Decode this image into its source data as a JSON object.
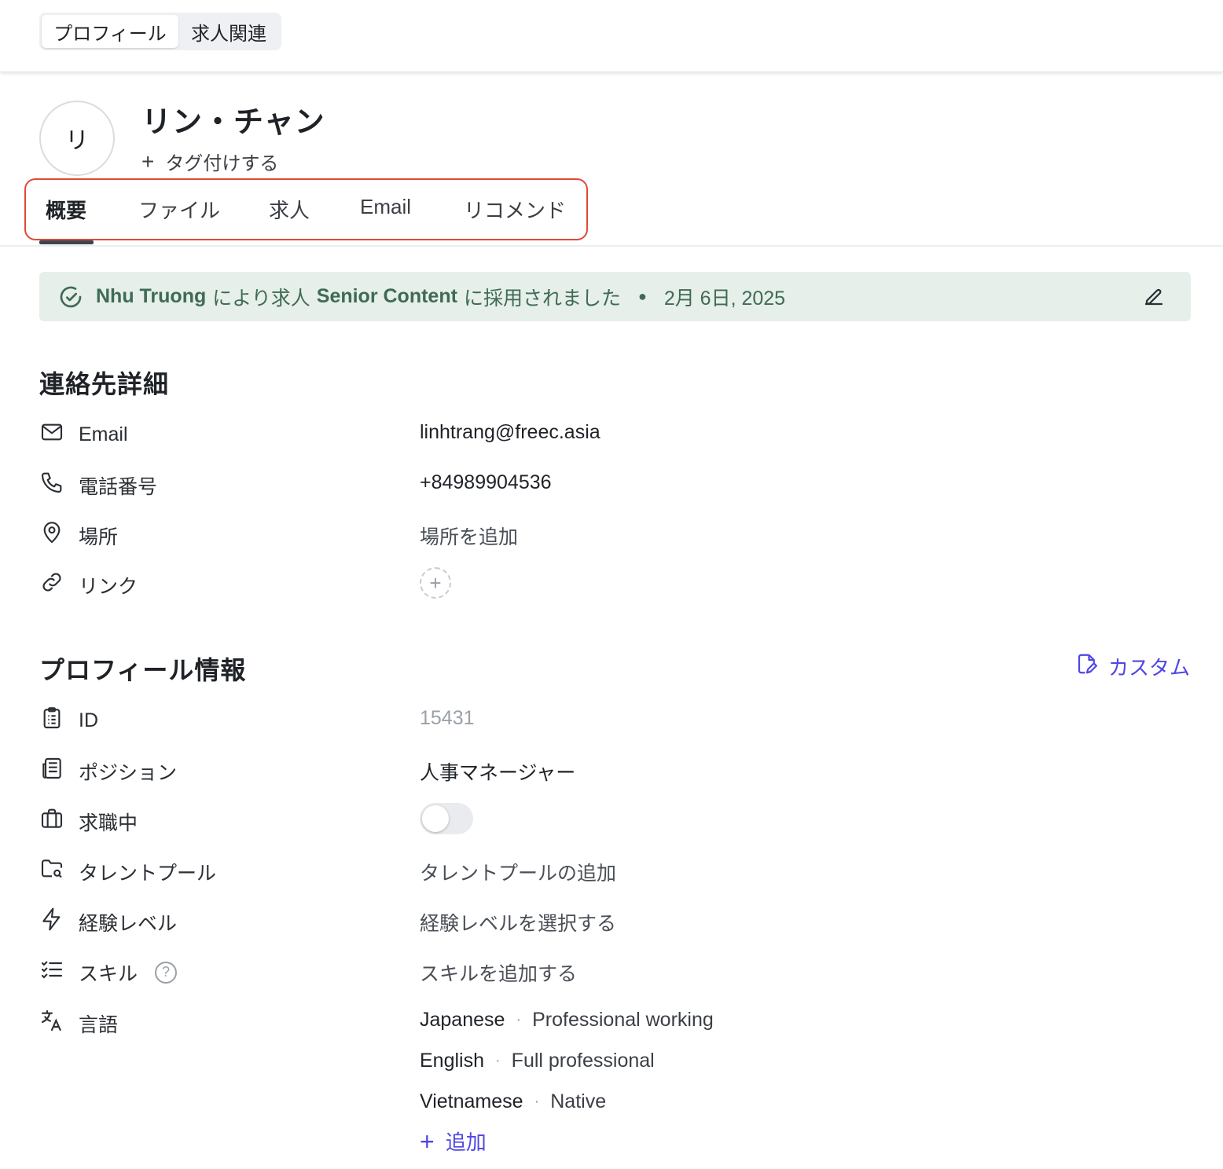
{
  "top_tabs": [
    {
      "label": "プロフィール",
      "active": true
    },
    {
      "label": "求人関連",
      "active": false
    }
  ],
  "candidate": {
    "avatar_initial": "リ",
    "name": "リン・チャン",
    "tag_action": "タグ付けする"
  },
  "tabs": [
    {
      "label": "概要",
      "active": true
    },
    {
      "label": "ファイル",
      "active": false
    },
    {
      "label": "求人",
      "active": false
    },
    {
      "label": "Email",
      "active": false
    },
    {
      "label": "リコメンド",
      "active": false
    }
  ],
  "banner": {
    "person": "Nhu Truong",
    "text1": "により求人",
    "job": "Senior Content",
    "text2": "に採用されました",
    "date": "2月 6日, 2025",
    "icons": {
      "status": "check-circle-icon",
      "edit": "pencil-icon"
    }
  },
  "contact": {
    "title": "連絡先詳細",
    "email_label": "Email",
    "email_value": "linhtrang@freec.asia",
    "phone_label": "電話番号",
    "phone_value": "+84989904536",
    "location_label": "場所",
    "location_placeholder": "場所を追加",
    "link_label": "リンク"
  },
  "profile": {
    "title": "プロフィール情報",
    "custom_label": "カスタム",
    "id_label": "ID",
    "id_value": "15431",
    "position_label": "ポジション",
    "position_value": "人事マネージャー",
    "job_seeking_label": "求職中",
    "job_seeking_on": false,
    "talent_pool_label": "タレントプール",
    "talent_pool_placeholder": "タレントプールの追加",
    "experience_label": "経験レベル",
    "experience_placeholder": "経験レベルを選択する",
    "skills_label": "スキル",
    "skills_placeholder": "スキルを追加する",
    "language_label": "言語",
    "languages": [
      {
        "name": "Japanese",
        "level": "Professional working"
      },
      {
        "name": "English",
        "level": "Full professional"
      },
      {
        "name": "Vietnamese",
        "level": "Native"
      }
    ],
    "add_language_label": "追加"
  },
  "colors": {
    "accent": "#4f46e5",
    "banner_bg": "#e6efe9",
    "banner_text": "#3f6b55",
    "highlight_outline": "#e04a36"
  }
}
